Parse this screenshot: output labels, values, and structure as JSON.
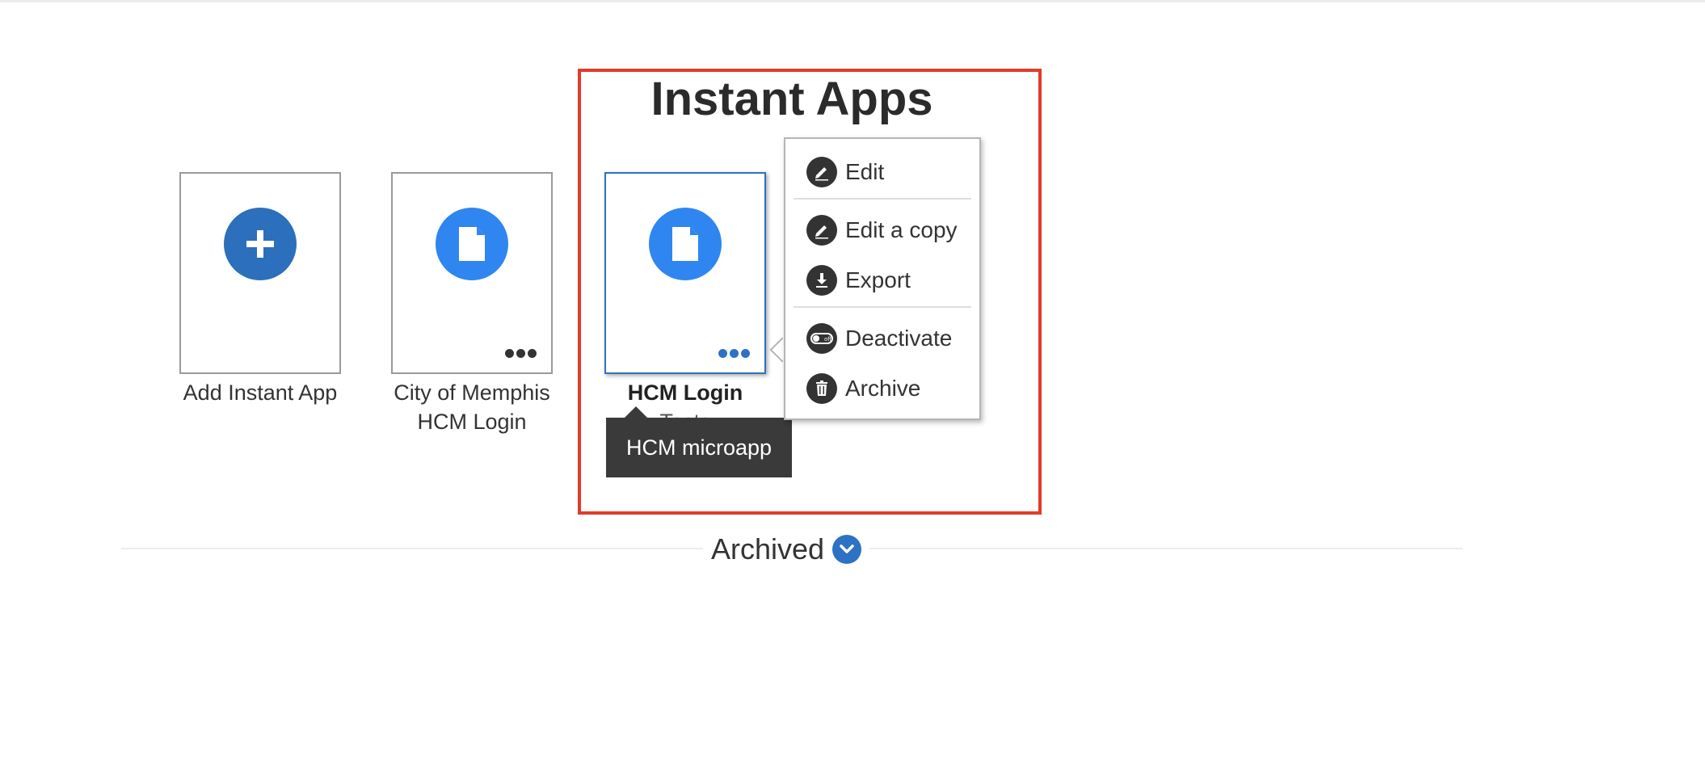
{
  "section": {
    "title": "Instant Apps"
  },
  "tiles": [
    {
      "label": "Add Instant App",
      "icon": "plus-icon"
    },
    {
      "label": "City of Memphis HCM Login",
      "icon": "document-icon",
      "more_icon": "more-dots-icon"
    },
    {
      "label": "HCM Login",
      "label_overflow": "Tests",
      "icon": "document-icon",
      "more_icon": "more-dots-icon"
    }
  ],
  "tooltip": {
    "text": "HCM microapp"
  },
  "context_menu": {
    "items": [
      {
        "label": "Edit",
        "icon": "pencil-icon"
      },
      {
        "label": "Edit a copy",
        "icon": "pencil-icon"
      },
      {
        "label": "Export",
        "icon": "download-icon"
      },
      {
        "label": "Deactivate",
        "icon": "toggle-off-icon"
      },
      {
        "label": "Archive",
        "icon": "trash-icon"
      }
    ]
  },
  "archived": {
    "label": "Archived",
    "icon": "chevron-down-icon"
  },
  "colors": {
    "accent": "#2d72c4",
    "tile_icon": "#2f86f0",
    "highlight": "#e23b2a",
    "tooltip_bg": "#3a3a3a"
  }
}
